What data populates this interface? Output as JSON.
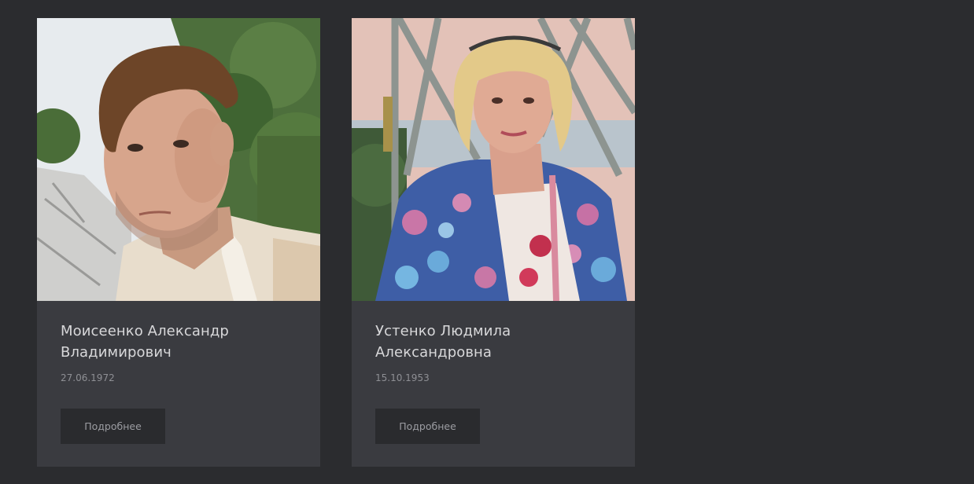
{
  "people": [
    {
      "name": "Моисеенко Александр Владимирович",
      "date": "27.06.1972",
      "button_label": "Подробнее"
    },
    {
      "name": "Устенко Людмила Александровна",
      "date": "15.10.1953",
      "button_label": "Подробнее"
    }
  ],
  "colors": {
    "page_bg": "#2b2c2f",
    "card_bg": "#3a3b40",
    "button_bg": "#2a2b2e"
  }
}
